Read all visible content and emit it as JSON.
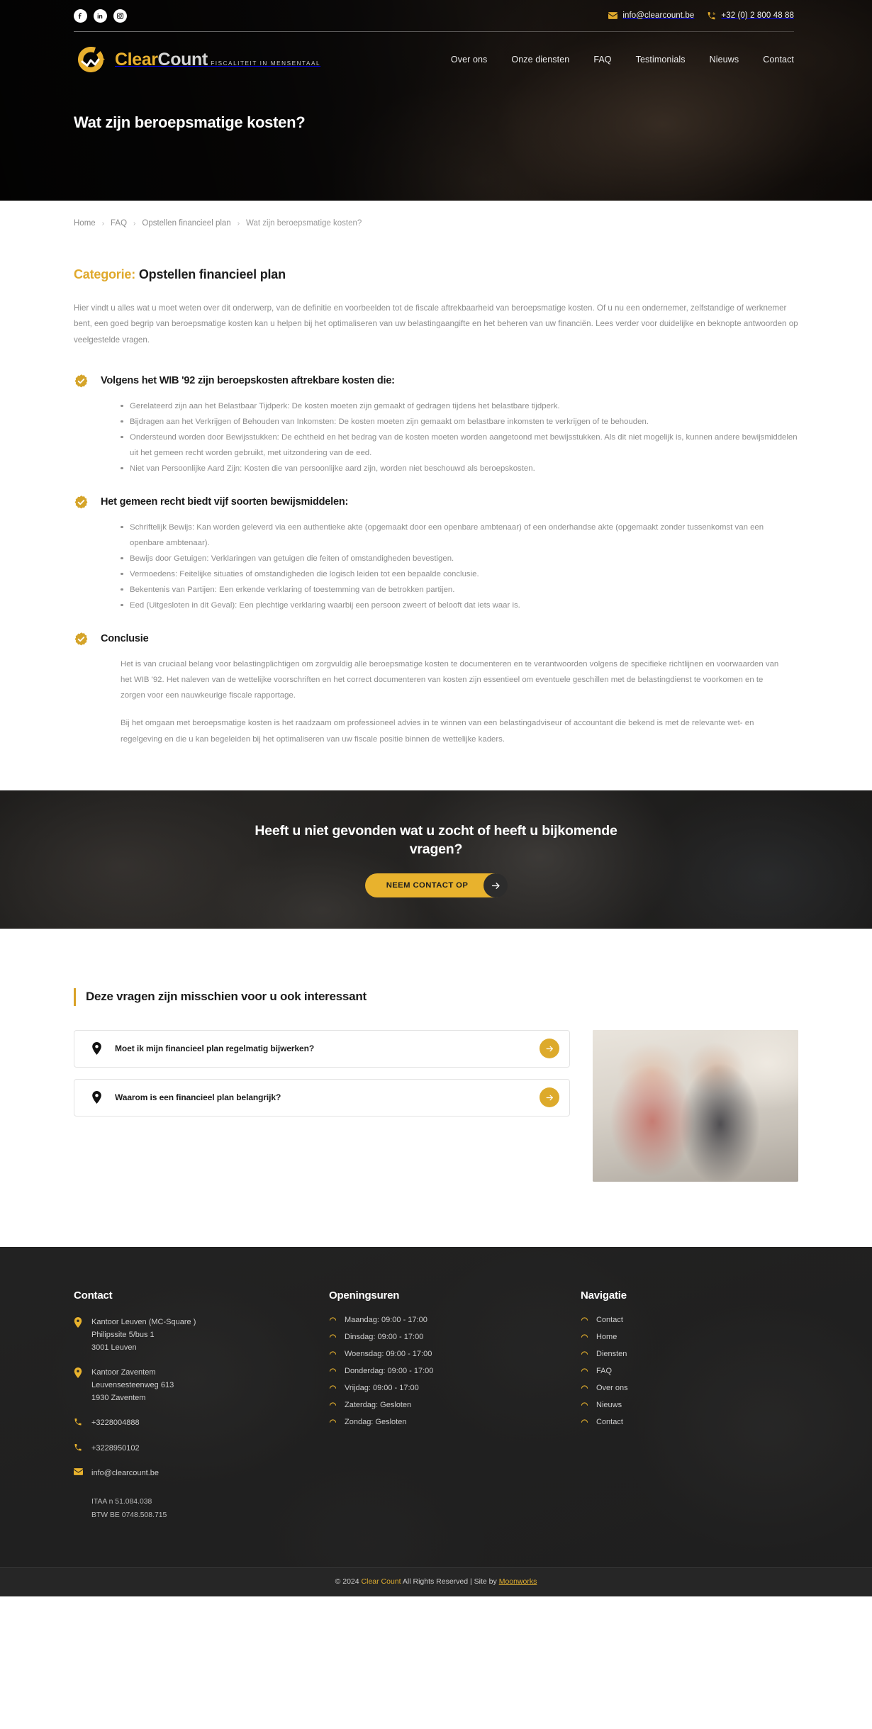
{
  "brand": {
    "name_part1": "Clear",
    "name_part2": "Count",
    "tagline": "FISCALITEIT IN MENSENTAAL",
    "accent": "#e0a92c",
    "dark": "#1b1b1b"
  },
  "topbar": {
    "social": [
      {
        "name": "facebook-icon",
        "label": "Facebook"
      },
      {
        "name": "linkedin-icon",
        "label": "LinkedIn"
      },
      {
        "name": "instagram-icon",
        "label": "Instagram"
      }
    ],
    "email": "info@clearcount.be",
    "phone": "+32 (0) 2 800 48 88"
  },
  "nav": {
    "items": [
      {
        "label": "Over ons"
      },
      {
        "label": "Onze diensten"
      },
      {
        "label": "FAQ"
      },
      {
        "label": "Testimonials"
      },
      {
        "label": "Nieuws"
      },
      {
        "label": "Contact"
      }
    ]
  },
  "hero": {
    "title": "Wat zijn beroepsmatige kosten?"
  },
  "breadcrumb": {
    "items": [
      {
        "label": "Home"
      },
      {
        "label": "FAQ"
      },
      {
        "label": "Opstellen financieel plan"
      },
      {
        "label": "Wat zijn beroepsmatige kosten?"
      }
    ],
    "separator": "›"
  },
  "article": {
    "category_label": "Categorie:",
    "category_value": "Opstellen financieel plan",
    "lead": "Hier vindt u alles wat u moet weten over dit onderwerp, van de definitie en voorbeelden tot de fiscale aftrekbaarheid van beroepsmatige kosten. Of u nu een ondernemer, zelfstandige of werknemer bent, een goed begrip van beroepsmatige kosten kan u helpen bij het optimaliseren van uw belastingaangifte en het beheren van uw financiën. Lees verder voor duidelijke en beknopte antwoorden op veelgestelde vragen.",
    "sections": [
      {
        "title": "Volgens het WIB '92 zijn beroepskosten aftrekbare kosten die:",
        "bullets": [
          "Gerelateerd zijn aan het Belastbaar Tijdperk: De kosten moeten zijn gemaakt of gedragen tijdens het belastbare tijdperk.",
          "Bijdragen aan het Verkrijgen of Behouden van Inkomsten: De kosten moeten zijn gemaakt om belastbare inkomsten te verkrijgen of te behouden.",
          "Ondersteund worden door Bewijsstukken: De echtheid en het bedrag van de kosten moeten worden aangetoond met bewijsstukken. Als dit niet mogelijk is, kunnen andere bewijsmiddelen uit het gemeen recht worden gebruikt, met uitzondering van de eed.",
          "Niet van Persoonlijke Aard Zijn: Kosten die van persoonlijke aard zijn, worden niet beschouwd als beroepskosten."
        ]
      },
      {
        "title": "Het gemeen recht biedt vijf soorten bewijsmiddelen:",
        "bullets": [
          "Schriftelijk Bewijs: Kan worden geleverd via een authentieke akte (opgemaakt door een openbare ambtenaar) of een onderhandse akte (opgemaakt zonder tussenkomst van een openbare ambtenaar).",
          "Bewijs door Getuigen: Verklaringen van getuigen die feiten of omstandigheden bevestigen.",
          "Vermoedens: Feitelijke situaties of omstandigheden die logisch leiden tot een bepaalde conclusie.",
          "Bekentenis van Partijen: Een erkende verklaring of toestemming van de betrokken partijen.",
          "Eed (Uitgesloten in dit Geval): Een plechtige verklaring waarbij een persoon zweert of belooft dat iets waar is."
        ]
      }
    ],
    "conclusion": {
      "title": "Conclusie",
      "paragraphs": [
        "Het is van cruciaal belang voor belastingplichtigen om zorgvuldig alle beroepsmatige kosten te documenteren en te verantwoorden volgens de specifieke richtlijnen en voorwaarden van het WIB '92. Het naleven van de wettelijke voorschriften en het correct documenteren van kosten zijn essentieel om eventuele geschillen met de belastingdienst te voorkomen en te zorgen voor een nauwkeurige fiscale rapportage.",
        "Bij het omgaan met beroepsmatige kosten is het raadzaam om professioneel advies in te winnen van een belastingadviseur of accountant die bekend is met de relevante wet- en regelgeving en die u kan begeleiden bij het optimaliseren van uw fiscale positie binnen de wettelijke kaders."
      ]
    }
  },
  "cta": {
    "title": "Heeft u niet gevonden wat u zocht of heeft u bijkomende vragen?",
    "button_label": "NEEM CONTACT OP",
    "button_color": "#e8b22d"
  },
  "related": {
    "heading": "Deze vragen zijn misschien voor u ook interessant",
    "items": [
      {
        "label": "Moet ik mijn financieel plan regelmatig bijwerken?"
      },
      {
        "label": "Waarom is een financieel plan belangrijk?"
      }
    ]
  },
  "footer": {
    "contact": {
      "title": "Contact",
      "offices": [
        {
          "name": "Kantoor Leuven (MC-Square )",
          "street": "Philipssite 5/bus 1",
          "city": "3001 Leuven"
        },
        {
          "name": "Kantoor Zaventem",
          "street": "Leuvensesteenweg 613",
          "city": "1930 Zaventem"
        }
      ],
      "phones": [
        "+3228004888",
        "+3228950102"
      ],
      "email": "info@clearcount.be",
      "legal": [
        "ITAA n 51.084.038",
        "BTW BE 0748.508.715"
      ]
    },
    "hours": {
      "title": "Openingsuren",
      "items": [
        "Maandag: 09:00 - 17:00",
        "Dinsdag: 09:00 - 17:00",
        "Woensdag: 09:00 - 17:00",
        "Donderdag: 09:00 - 17:00",
        "Vrijdag: 09:00 - 17:00",
        "Zaterdag: Gesloten",
        "Zondag: Gesloten"
      ]
    },
    "navigation": {
      "title": "Navigatie",
      "items": [
        "Contact",
        "Home",
        "Diensten",
        "FAQ",
        "Over ons",
        "Nieuws",
        "Contact"
      ]
    },
    "copyright": {
      "prefix": "© 2024",
      "brand": "Clear Count",
      "middle": "All Rights Reserved | Site by",
      "agency": "Moonworks"
    }
  }
}
